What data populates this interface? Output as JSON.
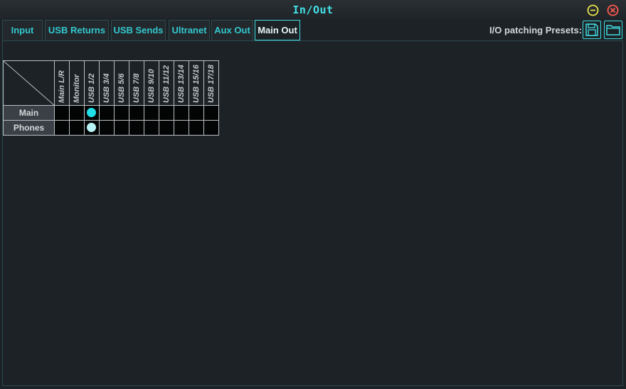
{
  "window": {
    "title": "In/Out",
    "min_icon": "minimize-icon",
    "close_icon": "close-icon"
  },
  "tabs": [
    {
      "label": "Input",
      "active": false
    },
    {
      "label": "USB Returns",
      "active": false
    },
    {
      "label": "USB Sends",
      "active": false
    },
    {
      "label": "Ultranet",
      "active": false
    },
    {
      "label": "Aux Out",
      "active": false
    },
    {
      "label": "Main Out",
      "active": true
    }
  ],
  "presets": {
    "label": "I/O patching Presets:",
    "save_icon": "save-icon",
    "open_icon": "folder-open-icon"
  },
  "matrix": {
    "columns": [
      "Main L/R",
      "Monitor",
      "USB 1/2",
      "USB 3/4",
      "USB 5/6",
      "USB 7/8",
      "USB 9/10",
      "USB 11/12",
      "USB 13/14",
      "USB 15/16",
      "USB 17/18"
    ],
    "rows": [
      {
        "label": "Main",
        "selected_col": 2,
        "dot_color": "#1fe0e8"
      },
      {
        "label": "Phones",
        "selected_col": 2,
        "dot_color": "#b8f3f5"
      }
    ]
  },
  "colors": {
    "accent": "#3fdde3",
    "background": "#1d2226"
  }
}
